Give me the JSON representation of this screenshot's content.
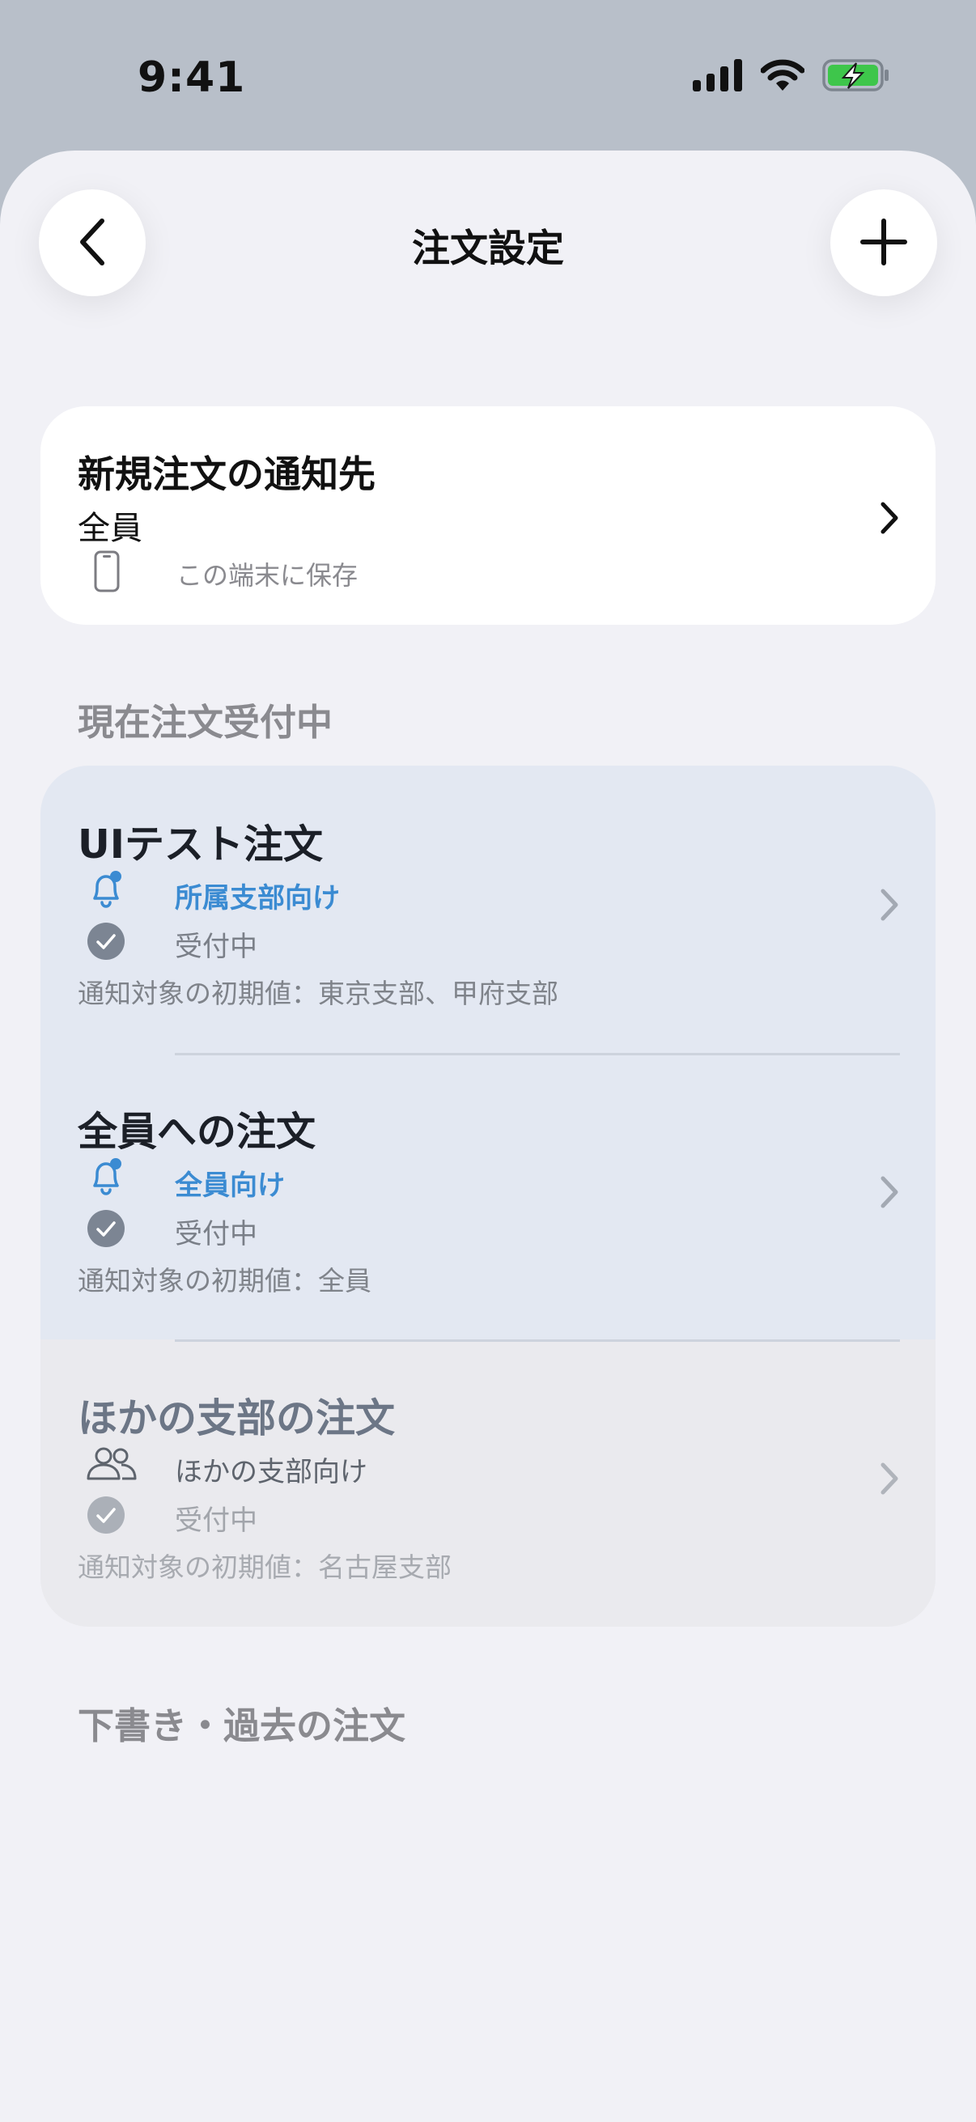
{
  "status_bar": {
    "time": "9:41",
    "icons": [
      "cellular-signal-icon",
      "wifi-icon",
      "battery-charging-icon"
    ],
    "battery_color": "#3ec64b"
  },
  "nav": {
    "title": "注文設定",
    "back_icon": "chevron-left-icon",
    "add_icon": "plus-icon"
  },
  "notify_card": {
    "title": "新規注文の通知先",
    "value": "全員",
    "device_icon": "phone-icon",
    "note": "この端末に保存"
  },
  "sections": {
    "current": "現在注文受付中",
    "draft": "下書き・過去の注文"
  },
  "orders": [
    {
      "title": "UIテスト注文",
      "audience_icon": "bell-badge-icon",
      "audience": "所属支部向け",
      "status": "受付中",
      "default_target": "通知対象の初期値：東京支部、甲府支部"
    },
    {
      "title": "全員への注文",
      "audience_icon": "bell-badge-icon",
      "audience": "全員向け",
      "status": "受付中",
      "default_target": "通知対象の初期値：全員"
    },
    {
      "title": "ほかの支部の注文",
      "audience_icon": "people-icon",
      "audience": "ほかの支部向け",
      "status": "受付中",
      "default_target": "通知対象の初期値：名古屋支部"
    }
  ],
  "colors": {
    "accent_blue": "#3b8bd2",
    "highlight_row": "#e3e8f2",
    "muted_row": "#eaeaee",
    "background": "#f1f1f6"
  }
}
